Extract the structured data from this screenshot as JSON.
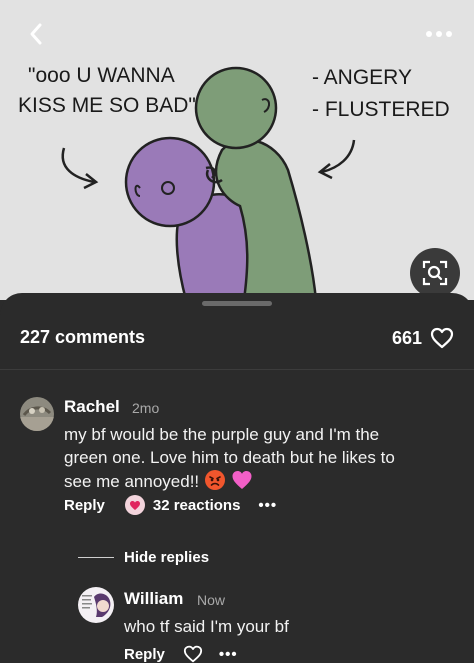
{
  "hero": {
    "caption_left_line1": "\"ooo U WANNA",
    "caption_left_line2": "KISS ME SO BAD\"",
    "caption_right_line1": "- ANGERY",
    "caption_right_line2": "- FLUSTERED",
    "back_icon": "chevron-left-icon",
    "more_icon": "more-horizontal-icon",
    "lens_icon": "visual-search-icon"
  },
  "sheet": {
    "comments_label": "227 comments",
    "likes_count": "661"
  },
  "comments": [
    {
      "author": "Rachel",
      "time": "2mo",
      "text_line1": "my bf would be the purple guy and I'm the",
      "text_line2": "green one. Love him to death but he likes to",
      "text_line3": "see me annoyed!!",
      "reply_label": "Reply",
      "reactions_label": "32 reactions",
      "more_label": "•••"
    }
  ],
  "replies": {
    "toggle_label": "Hide replies",
    "items": [
      {
        "author": "William",
        "time": "Now",
        "text": "who tf said I'm your bf",
        "reply_label": "Reply",
        "more_label": "•••"
      }
    ]
  },
  "colors": {
    "sheet_bg": "#2b2b2b",
    "hero_bg": "#e2e2e2",
    "purple_character": "#9a7ab8",
    "green_character": "#7e9d78",
    "reaction_badge": "#e0245e"
  }
}
